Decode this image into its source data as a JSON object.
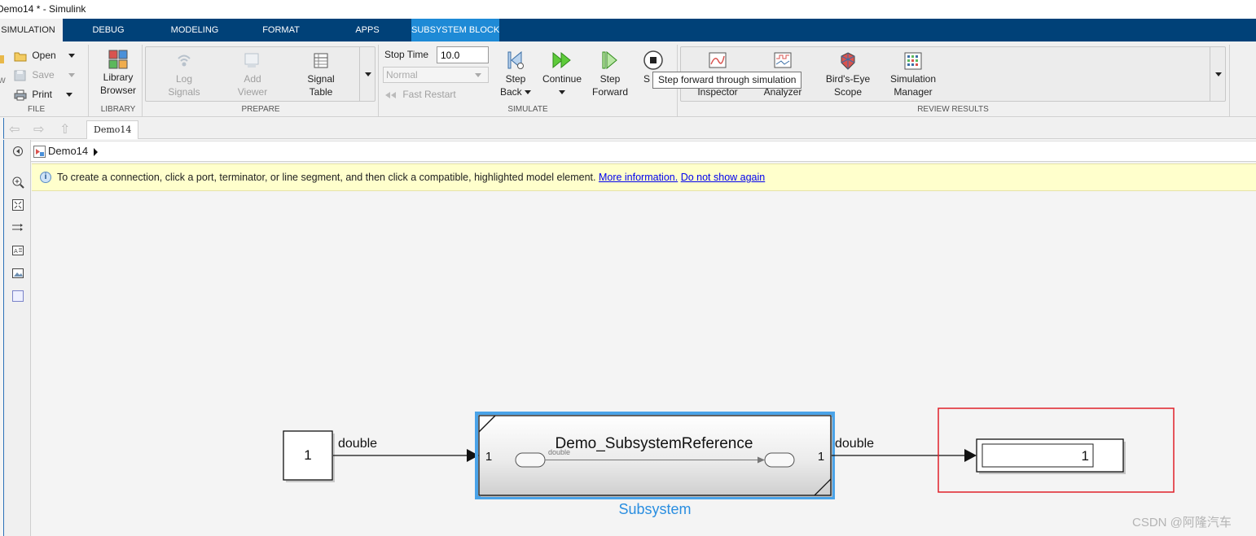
{
  "window": {
    "title": "Demo14 * - Simulink"
  },
  "tabs": [
    {
      "label": "SIMULATION",
      "active": true
    },
    {
      "label": "DEBUG"
    },
    {
      "label": "MODELING"
    },
    {
      "label": "FORMAT"
    },
    {
      "label": "APPS"
    },
    {
      "label": "SUBSYSTEM BLOCK",
      "contextual": true
    }
  ],
  "ribbon": {
    "file": {
      "label": "FILE",
      "new_fragment": "w",
      "open": "Open",
      "save": "Save",
      "print": "Print"
    },
    "library": {
      "label": "LIBRARY",
      "browser": [
        "Library",
        "Browser"
      ]
    },
    "prepare": {
      "label": "PREPARE",
      "log_signals": [
        "Log",
        "Signals"
      ],
      "add_viewer": [
        "Add",
        "Viewer"
      ],
      "signal_table": [
        "Signal",
        "Table"
      ]
    },
    "simulate": {
      "label": "SIMULATE",
      "stop_time_label": "Stop Time",
      "stop_time_value": "10.0",
      "mode": "Normal",
      "fast_restart": "Fast Restart",
      "step_back": [
        "Step",
        "Back"
      ],
      "continue": "Continue",
      "step_forward": [
        "Step",
        "Forward"
      ],
      "stop_fragment": "S"
    },
    "review": {
      "label": "REVIEW RESULTS",
      "inspector_fragment": "Inspector",
      "analyzer_fragment": "Analyzer",
      "birds_eye": [
        "Bird's-Eye",
        "Scope"
      ],
      "sim_manager": [
        "Simulation",
        "Manager"
      ]
    },
    "tooltip": "Step forward through simulation"
  },
  "editor": {
    "doc_tab": "Demo14",
    "breadcrumb": "Demo14",
    "info_message": "To create a connection, click a port, terminator, or line segment, and then click a compatible, highlighted model element.",
    "more_info": "More information.",
    "dont_show": "Do not show again"
  },
  "diagram": {
    "constant_value": "1",
    "signal_in_label": "double",
    "signal_out_label": "double",
    "subsystem_title": "Demo_SubsystemReference",
    "subsystem_inner_label": "double",
    "subsystem_in_port": "1",
    "subsystem_out_port": "1",
    "subsystem_name": "Subsystem",
    "display_value": "1"
  },
  "watermark": "CSDN @阿隆汽车",
  "colors": {
    "tab_bar": "#004178",
    "context_tab": "#1e8ad6",
    "selection": "#4aa3e8",
    "highlight_box": "#e0202a",
    "info_bar": "#ffffcc"
  }
}
